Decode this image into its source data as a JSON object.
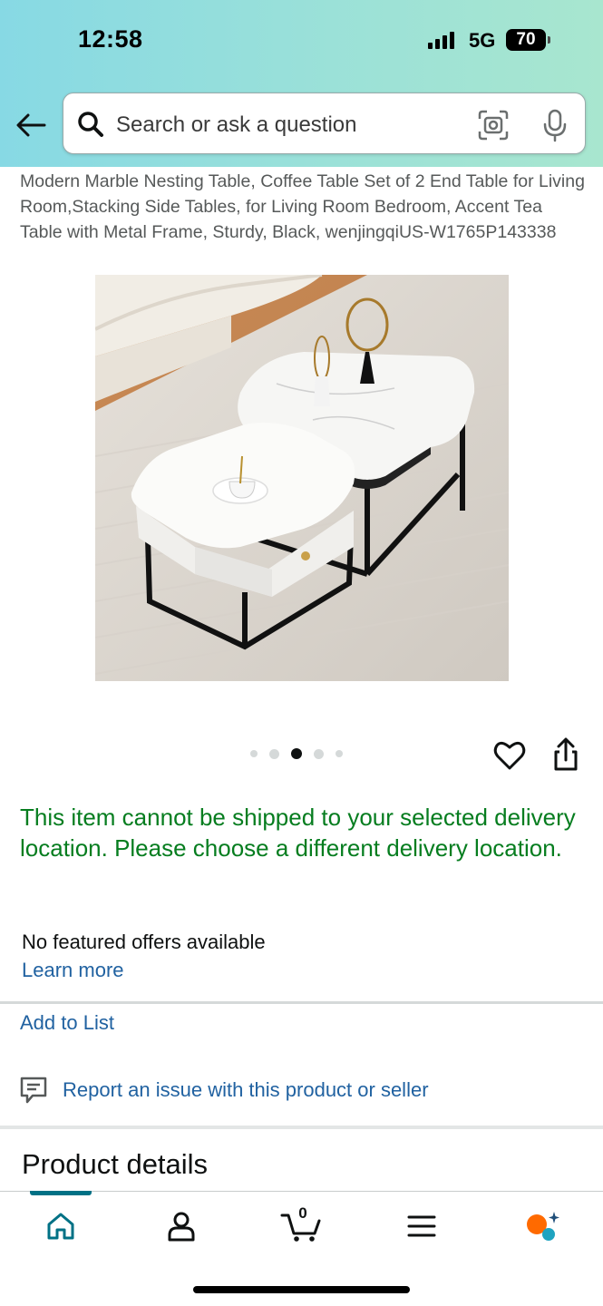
{
  "status_bar": {
    "time": "12:58",
    "network": "5G",
    "battery": "70"
  },
  "search": {
    "placeholder": "Search or ask a question"
  },
  "product": {
    "title": "Modern Marble Nesting Table, Coffee Table Set of 2 End Table for Living Room,Stacking Side Tables, for Living Room Bedroom, Accent Tea Table with Metal Frame, Sturdy, Black, wenjingqiUS-W1765P143338",
    "image_count": 5,
    "active_image_index": 2
  },
  "shipping_message": "This item cannot be shipped to your selected delivery location. Please choose a different delivery location.",
  "offers": {
    "no_featured": "No featured offers available",
    "learn_more": "Learn more"
  },
  "actions": {
    "add_to_list": "Add to List",
    "report_issue": "Report an issue with this product or seller"
  },
  "sections": {
    "product_details": "Product details"
  },
  "bottom_nav": {
    "items": [
      {
        "name": "home",
        "icon": "home-icon",
        "active": true
      },
      {
        "name": "account",
        "icon": "person-icon"
      },
      {
        "name": "cart",
        "icon": "cart-icon",
        "count": "0"
      },
      {
        "name": "menu",
        "icon": "menu-icon"
      },
      {
        "name": "rufus",
        "icon": "rufus-icon"
      }
    ]
  },
  "colors": {
    "link": "#2162a1",
    "success": "#067d1f",
    "nav_accent": "#007185",
    "rufus_orange": "#ff6a00",
    "rufus_teal": "#1fa3c0"
  }
}
